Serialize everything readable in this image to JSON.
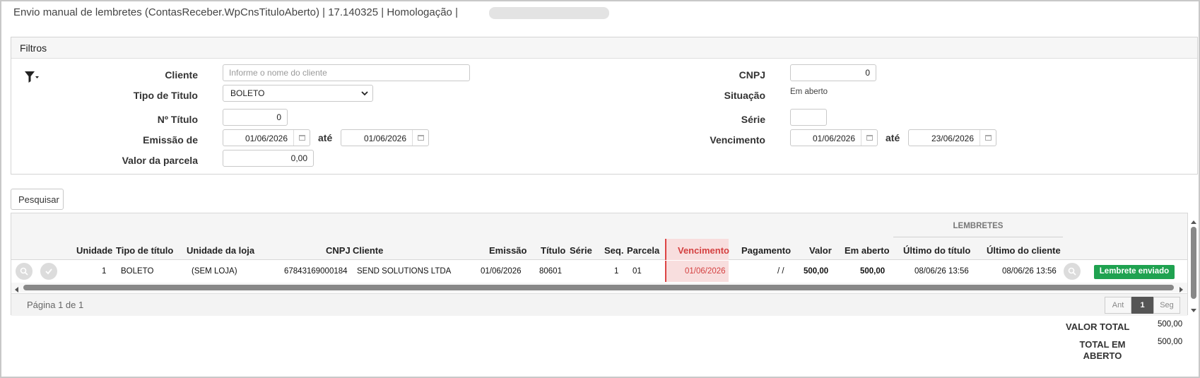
{
  "title": "Envio manual de lembretes (ContasReceber.WpCnsTituloAberto) | 17.140325 | Homologação |",
  "filters": {
    "header": "Filtros",
    "cliente_label": "Cliente",
    "cliente_placeholder": "Informe o nome do cliente",
    "tipo_label": "Tipo de Titulo",
    "tipo_value": "BOLETO",
    "ntitulo_label": "Nº Título",
    "ntitulo_value": "0",
    "emissao_label": "Emissão de",
    "emissao_from": "01/06/2026",
    "ate_label": "até",
    "emissao_to": "01/06/2026",
    "valor_label": "Valor da parcela",
    "valor_value": "0,00",
    "cnpj_label": "CNPJ",
    "cnpj_value": "0",
    "situacao_label": "Situação",
    "situacao_value": "Em aberto",
    "serie_label": "Série",
    "serie_value": "",
    "vencimento_label": "Vencimento",
    "venc_from": "01/06/2026",
    "venc_to": "23/06/2026"
  },
  "search_button": "Pesquisar",
  "grid": {
    "group_header": "LEMBRETES",
    "columns": {
      "unidade": "Unidade",
      "tipo": "Tipo de título",
      "unidade_loja": "Unidade da loja",
      "cnpj": "CNPJ",
      "cliente": "Cliente",
      "emissao": "Emissão",
      "titulo": "Título",
      "serie": "Série",
      "seq": "Seq.",
      "parcela": "Parcela",
      "vencimento": "Vencimento",
      "pagamento": "Pagamento",
      "valor": "Valor",
      "em_aberto": "Em aberto",
      "ultimo_titulo": "Último do título",
      "ultimo_cliente": "Último do cliente"
    },
    "row": {
      "unidade": "1",
      "tipo": "BOLETO",
      "unidade_loja": "(SEM LOJA)",
      "cnpj": "67843169000184",
      "cliente": "SEND SOLUTIONS LTDA",
      "emissao": "01/06/2026",
      "titulo": "80601",
      "serie": "",
      "seq": "1",
      "parcela": "01",
      "vencimento": "01/06/2026",
      "pagamento": "/ /",
      "valor": "500,00",
      "em_aberto": "500,00",
      "ultimo_titulo": "08/06/26 13:56",
      "ultimo_cliente": "08/06/26 13:56",
      "badge": "Lembrete enviado"
    },
    "pager_text": "Página 1 de 1",
    "prev": "Ant",
    "page": "1",
    "next": "Seg"
  },
  "totals": {
    "valor_total_label": "VALOR TOTAL",
    "valor_total": "500,00",
    "total_aberto_label_1": "TOTAL EM",
    "total_aberto_label_2": "ABERTO",
    "total_aberto": "500,00"
  },
  "colors": {
    "accent_red": "#d44040",
    "badge_green": "#1fa250"
  }
}
